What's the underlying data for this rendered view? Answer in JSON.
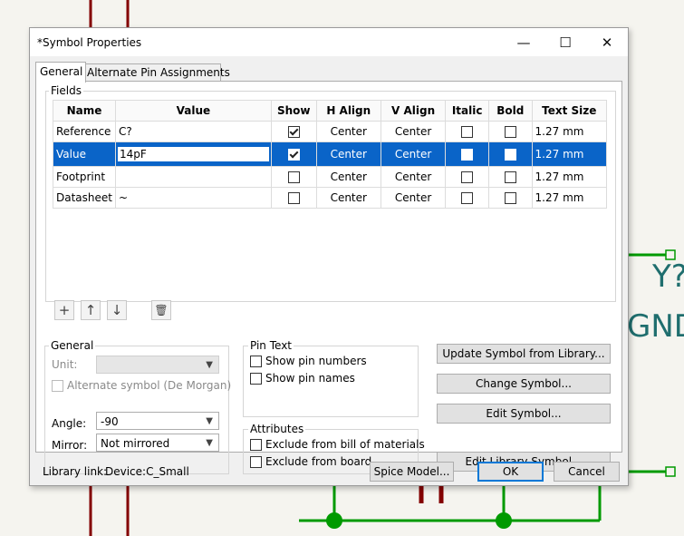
{
  "background": {
    "component_ref": "Y?",
    "net_label": "GND"
  },
  "dialog": {
    "title": "*Symbol Properties",
    "window_buttons": {
      "minimize": "—",
      "maximize": "☐",
      "close": "✕"
    },
    "tabs": [
      "General",
      "Alternate Pin Assignments"
    ],
    "fields_group_label": "Fields",
    "table": {
      "columns": [
        "Name",
        "Value",
        "Show",
        "H Align",
        "V Align",
        "Italic",
        "Bold",
        "Text Size"
      ],
      "rows": [
        {
          "name": "Reference",
          "value": "C?",
          "show": true,
          "h_align": "Center",
          "v_align": "Center",
          "italic": false,
          "bold": false,
          "text_size": "1.27 mm",
          "selected": false
        },
        {
          "name": "Value",
          "value": "14pF",
          "show": true,
          "h_align": "Center",
          "v_align": "Center",
          "italic": false,
          "bold": false,
          "text_size": "1.27 mm",
          "selected": true
        },
        {
          "name": "Footprint",
          "value": "",
          "show": false,
          "h_align": "Center",
          "v_align": "Center",
          "italic": false,
          "bold": false,
          "text_size": "1.27 mm",
          "selected": false
        },
        {
          "name": "Datasheet",
          "value": "~",
          "show": false,
          "h_align": "Center",
          "v_align": "Center",
          "italic": false,
          "bold": false,
          "text_size": "1.27 mm",
          "selected": false
        }
      ]
    },
    "grid_buttons": {
      "add": "+",
      "up": "↑",
      "down": "↓",
      "delete": "🗑"
    },
    "general": {
      "label": "General",
      "unit_label": "Unit:",
      "unit_value": "",
      "alternate_symbol_label": "Alternate symbol (De Morgan)",
      "angle_label": "Angle:",
      "angle_value": "-90",
      "mirror_label": "Mirror:",
      "mirror_value": "Not mirrored"
    },
    "pin_text": {
      "label": "Pin Text",
      "show_pin_numbers": "Show pin numbers",
      "show_pin_names": "Show pin names"
    },
    "attributes": {
      "label": "Attributes",
      "exclude_bom": "Exclude from bill of materials",
      "exclude_board": "Exclude from board"
    },
    "actions": {
      "update_from_library": "Update Symbol from Library...",
      "change_symbol": "Change Symbol...",
      "edit_symbol": "Edit Symbol...",
      "edit_library_symbol": "Edit Library Symbol..."
    },
    "footer": {
      "library_link_label": "Library link:",
      "library_link_value": "Device:C_Small",
      "spice_model": "Spice Model...",
      "ok": "OK",
      "cancel": "Cancel"
    }
  },
  "colors": {
    "wire_green": "#009a00",
    "wire_red": "#840000",
    "text_teal": "#1f6e6e",
    "selection_blue": "#0a64c8"
  }
}
